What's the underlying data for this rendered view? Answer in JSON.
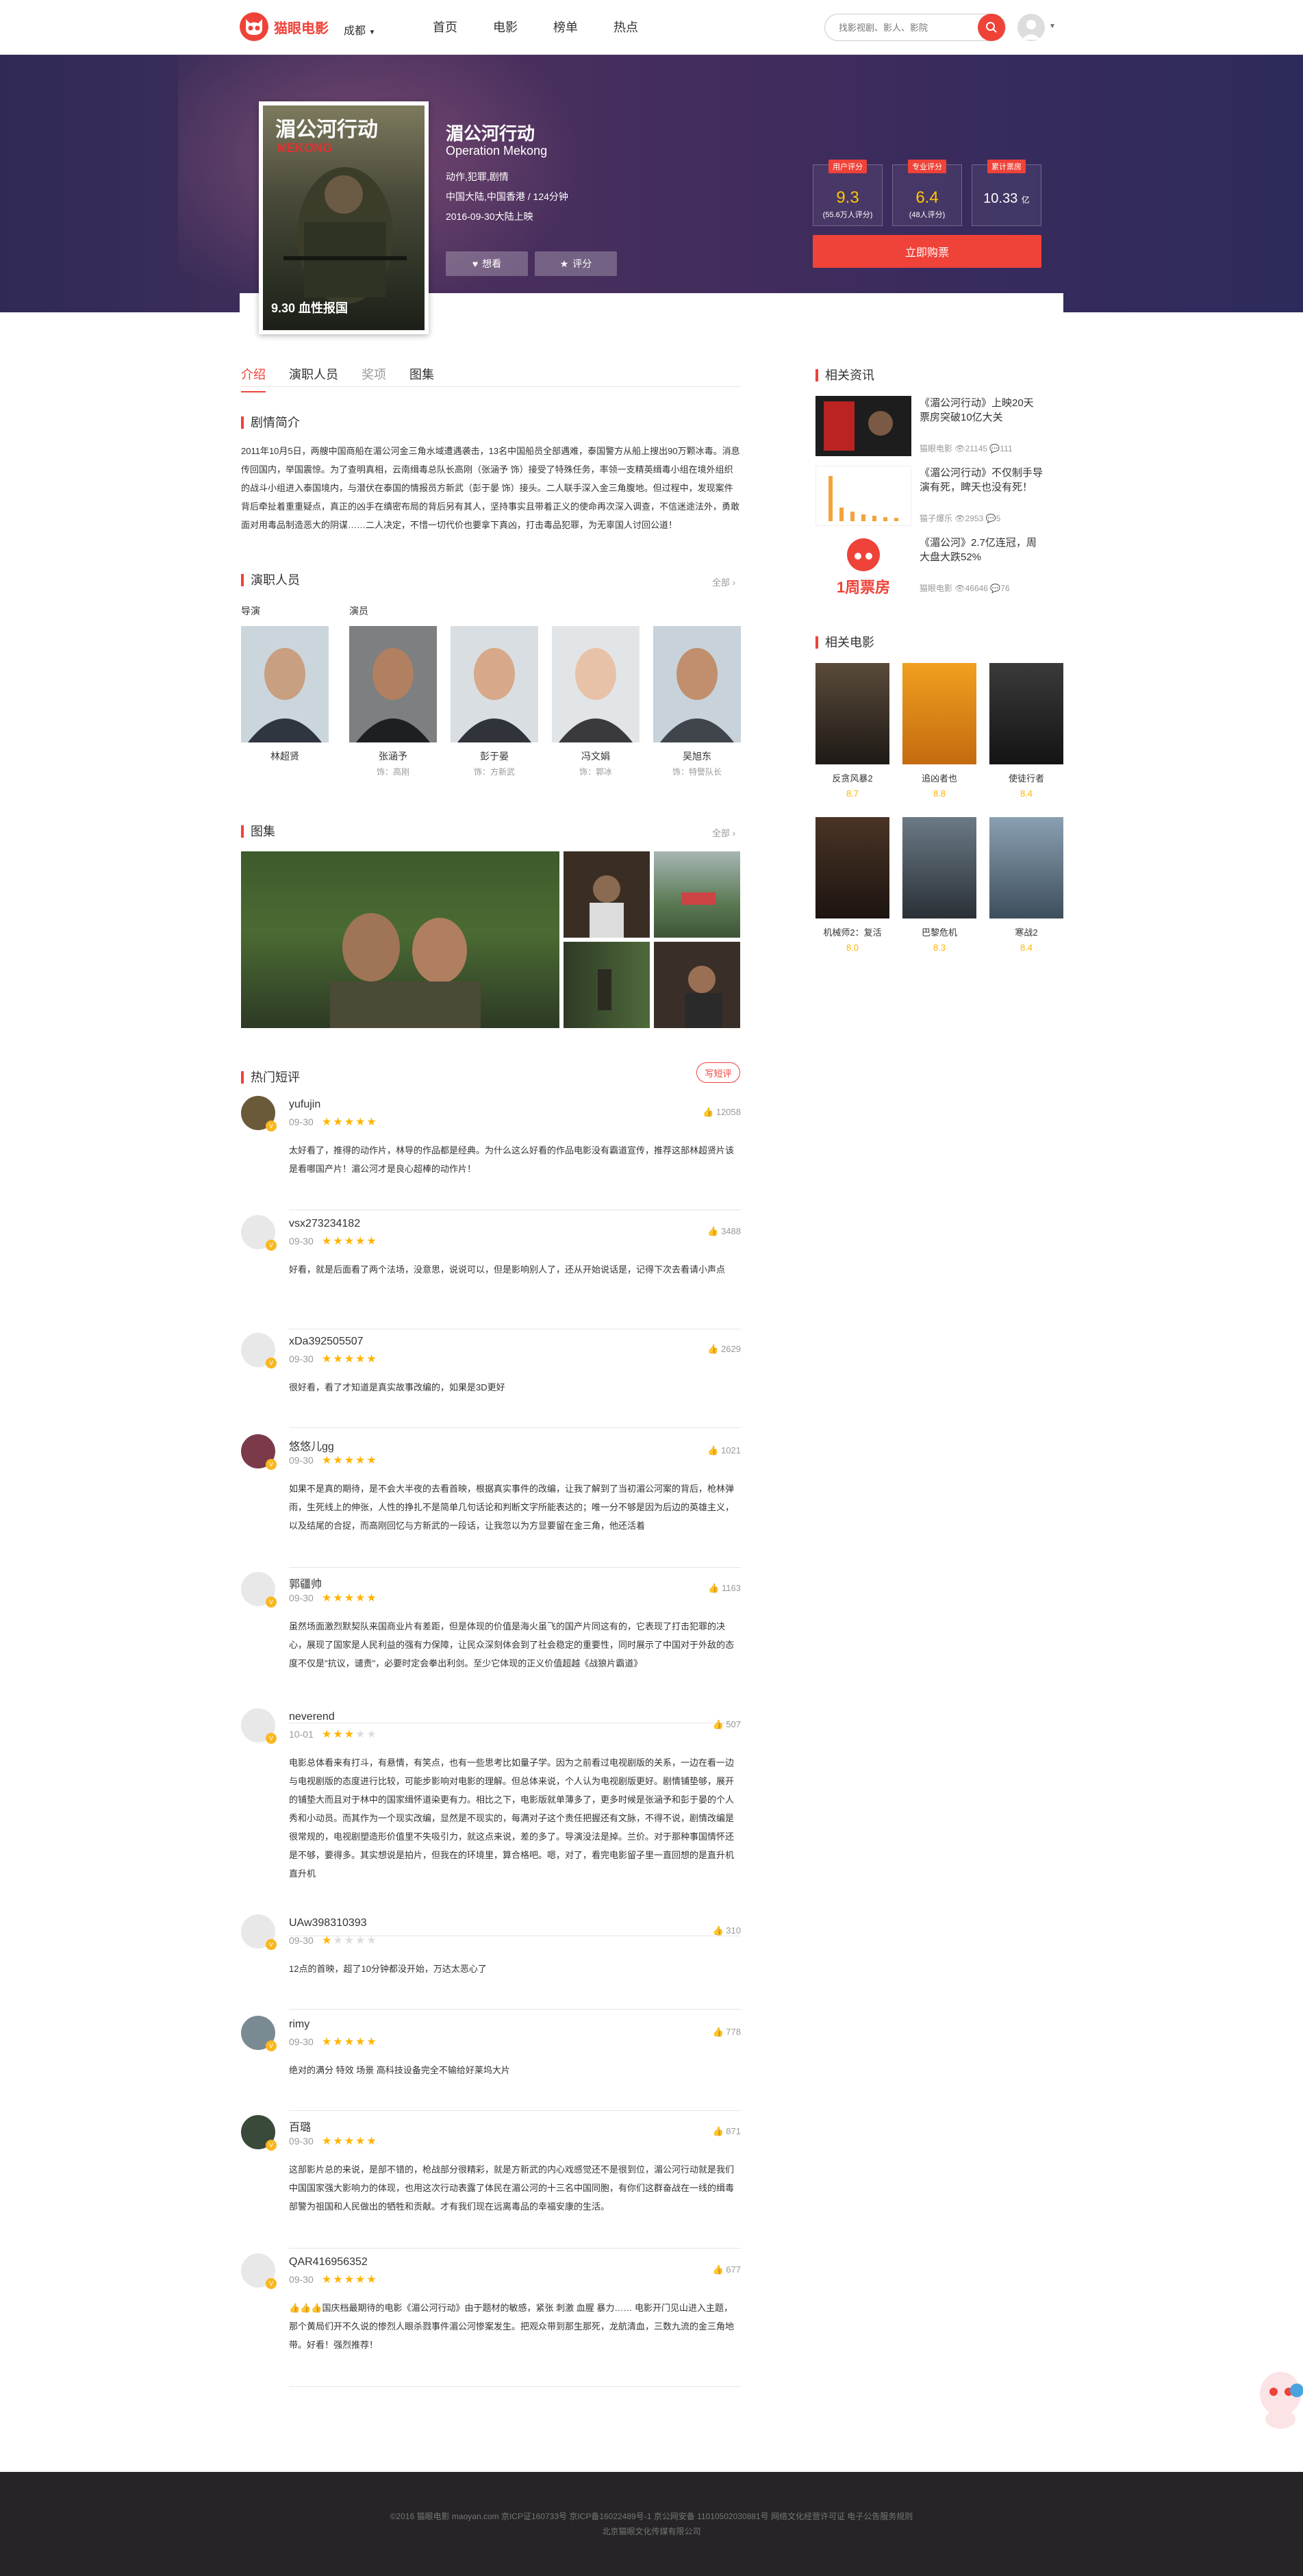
{
  "header": {
    "logo_text": "猫眼电影",
    "city": "成都",
    "nav": [
      "首页",
      "电影",
      "榜单",
      "热点"
    ],
    "search_placeholder": "找影视剧、影人、影院"
  },
  "movie": {
    "poster_title": "湄公河行动",
    "poster_subtitle": "MEKONG",
    "poster_date": "9.30 血性报国",
    "title": "湄公河行动",
    "title_en": "Operation Mekong",
    "genres": "动作,犯罪,剧情",
    "region_length": "中国大陆,中国香港 / 124分钟",
    "release": "2016-09-30大陆上映",
    "want_label": "想看",
    "rate_label": "评分",
    "stats": [
      {
        "tag": "用户评分",
        "value": "9.3",
        "sub": "(55.6万人评分)"
      },
      {
        "tag": "专业评分",
        "value": "6.4",
        "sub": "(48人评分)"
      },
      {
        "tag": "累计票房",
        "value": "10.33",
        "unit": "亿"
      }
    ],
    "buy_label": "立即购票"
  },
  "tabs": [
    "介绍",
    "演职人员",
    "奖项",
    "图集"
  ],
  "synopsis": {
    "title": "剧情简介",
    "text": "2011年10月5日，两艘中国商船在湄公河金三角水域遭遇袭击，13名中国船员全部遇难，泰国警方从船上搜出90万颗冰毒。消息传回国内，举国震惊。为了查明真相，云南缉毒总队长高刚（张涵予 饰）接受了特殊任务，率领一支精英缉毒小组在境外组织的战斗小组进入泰国境内，与潜伏在泰国的情报员方新武（彭于晏 饰）接头。二人联手深入金三角腹地。但过程中，发现案件背后牵扯着重重疑点，真正的凶手在缜密布局的背后另有其人，坚持事实且带着正义的使命再次深入调查，不信迷途法外，勇敢面对用毒品制造恶大的阴谋……二人决定，不惜一切代价也要拿下真凶，打击毒品犯罪，为无辜国人讨回公道！"
  },
  "cast": {
    "title": "演职人员",
    "more": "全部",
    "director_label": "导演",
    "actor_label": "演员",
    "people": [
      {
        "name": "林超贤",
        "role": ""
      },
      {
        "name": "张涵予",
        "role": "饰：高刚"
      },
      {
        "name": "彭于晏",
        "role": "饰：方新武"
      },
      {
        "name": "冯文娟",
        "role": "饰：郭冰"
      },
      {
        "name": "吴旭东",
        "role": "饰：特警队长"
      }
    ]
  },
  "gallery": {
    "title": "图集",
    "more": "全部"
  },
  "reviews": {
    "title": "热门短评",
    "write_label": "写短评",
    "items": [
      {
        "name": "yufujin",
        "date": "09-30",
        "stars": 5,
        "likes": "12058",
        "text": "太好看了，推得的动作片，林导的作品都是经典。为什么这么好看的作品电影没有霸道宣传，推荐这部林超贤片该是看哪国产片！湄公河才是良心超棒的动作片！"
      },
      {
        "name": "vsx273234182",
        "date": "09-30",
        "stars": 4.5,
        "likes": "3488",
        "text": "好看，就是后面看了两个法场，没意思，说说可以，但是影响别人了，还从开始说话是，记得下次去看请小声点"
      },
      {
        "name": "xDa392505507",
        "date": "09-30",
        "stars": 5,
        "likes": "2629",
        "text": "很好看，看了才知道是真实故事改编的，如果是3D更好"
      },
      {
        "name": "悠悠儿gg",
        "date": "09-30",
        "stars": 4.5,
        "likes": "1021",
        "text": "如果不是真的期待，是不会大半夜的去看首映，根据真实事件的改编，让我了解到了当初湄公河案的背后，枪林弹雨，生死线上的伸张，人性的挣扎不是简单几句话论和判断文字所能表达的；唯一分不够是因为后边的英雄主义，以及结尾的合捉，而高刚回忆与方新武的一段话，让我忽以为方显要留在金三角，他还活着"
      },
      {
        "name": "郭疆帅",
        "date": "09-30",
        "stars": 4.5,
        "likes": "1163",
        "text": "虽然场面激烈默契队来国商业片有差距，但是体现的价值是海火虽飞的国产片同这有的，它表现了打击犯罪的决心，展现了国家是人民利益的强有力保障，让民众深刻体会到了社会稳定的重要性，同时展示了中国对于外敌的态度不仅是\"抗议，谴责\"，必要时定会拳出利剑。至少它体现的正义价值超越《战狼片霸道》"
      },
      {
        "name": "neverend",
        "date": "10-01",
        "stars": 3,
        "likes": "507",
        "text": "电影总体看来有打斗，有悬情，有笑点，也有一些思考比如量子学。因为之前看过电视剧版的关系，一边在看一边与电视剧版的态度进行比较，可能步影响对电影的理解。但总体来说，个人认为电视剧版更好。剧情铺垫够，展开的铺垫大而且对于林中的国家缉怀道染更有力。相比之下，电影版就单薄多了，更多时候是张涵予和彭于晏的个人秀和小动员。而其作为一个现实改编，显然是不现实的，每满对子这个责任把握还有文脉，不得不说，剧情改编是很常规的，电视剧塑造形价值里不失吸引力，就这点来说，差的多了。导演没法是掉。兰价。对于那种事国情怀还是不够，要得多。其实想说是拍片，但我在的环境里，算合格吧。嗯，对了，看完电影留子里一直回想的是直升机直升机"
      },
      {
        "name": "UAw398310393",
        "date": "09-30",
        "stars": 1,
        "likes": "310",
        "text": "12点的首映，超了10分钟都没开始，万达太恶心了"
      },
      {
        "name": "rimy",
        "date": "09-30",
        "stars": 5,
        "likes": "778",
        "text": "绝对的满分 特效 场景 高科技设备完全不输给好莱坞大片"
      },
      {
        "name": "百璐",
        "date": "09-30",
        "stars": 5,
        "likes": "871",
        "text": "这部影片总的来说，是部不错的，枪战部分很精彩，就是方新武的内心戏感觉还不是很到位，湄公河行动就是我们中国国家强大影响力的体现，也用这次行动表露了体民在湄公河的十三名中国同胞，有你们这群奋战在一线的缉毒部警为祖国和人民做出的牺牲和贡献。才有我们现在远离毒品的幸福安康的生活。"
      },
      {
        "name": "QAR416956352",
        "date": "09-30",
        "stars": 5,
        "likes": "677",
        "text": "👍👍👍国庆档最期待的电影《湄公河行动》由于题材的敏感，紧张 刺激 血腥 暴力…… 电影开门见山进入主题，那个黄局们开不久说的惨烈人眼杀戮事件湄公河惨案发生。把观众带到那生那死，龙航清血，三数九流的金三角地带。好看！强烈推荐！"
      }
    ]
  },
  "sidebar": {
    "news_title": "相关资讯",
    "news": [
      {
        "title": "《湄公河行动》上映20天票房突破10亿大关",
        "source": "猫眼电影",
        "views": "21145",
        "comments": "111"
      },
      {
        "title": "《湄公河行动》不仅制手导演有死，睥天也没有死！",
        "source": "猫子爆乐",
        "views": "2953",
        "comments": "5"
      },
      {
        "title": "《湄公河》2.7亿连冠，周大盘大跌52%",
        "source": "猫眼电影",
        "views": "46646",
        "comments": "76"
      }
    ],
    "news3_logo_text": "1周票房",
    "related_title": "相关电影",
    "related": [
      {
        "name": "反贪风暴2",
        "score": "8.7"
      },
      {
        "name": "追凶者也",
        "score": "8.8"
      },
      {
        "name": "使徒行者",
        "score": "8.4"
      },
      {
        "name": "机械师2：复活",
        "score": "8.0"
      },
      {
        "name": "巴黎危机",
        "score": "8.3"
      },
      {
        "name": "寒战2",
        "score": "8.4"
      }
    ]
  },
  "footer": {
    "line1": "©2016 猫眼电影 maoyan.com 京ICP证160733号 京ICP备16022489号-1 京公网安备 11010502030881号 网络文化经营许可证 电子公告服务规则",
    "line2": "北京猫眼文化传媒有限公司"
  },
  "colors": {
    "brand": "#ef4238",
    "star": "#ffb400",
    "score": "#ffc600",
    "banner": "#3b2b5d"
  }
}
